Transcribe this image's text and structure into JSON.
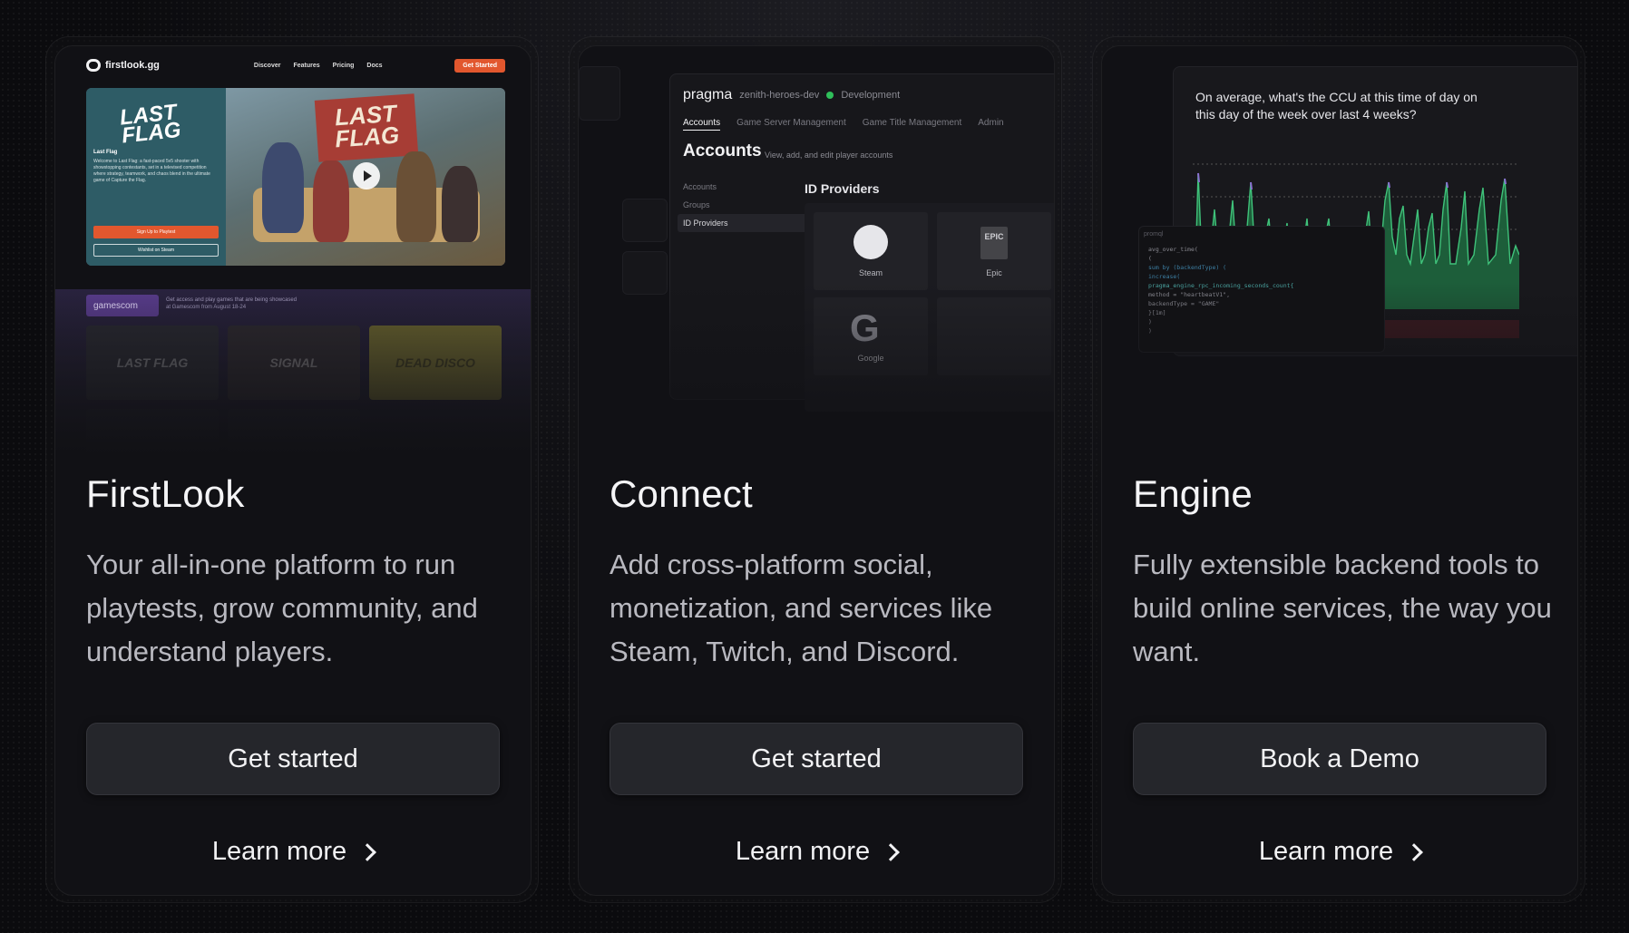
{
  "cards": [
    {
      "title": "FirstLook",
      "description": "Your all-in-one platform to run playtests, grow community, and understand players.",
      "cta_label": "Get started",
      "learn_more_label": "Learn more",
      "preview": {
        "logo": "firstlook.gg",
        "nav": [
          "Discover",
          "Features",
          "Pricing",
          "Docs"
        ],
        "nav_cta": "Get Started",
        "hero_logo": "LAST FLAG",
        "hero_title": "Last Flag",
        "hero_text": "Welcome to Last Flag: a fast-paced 5v5 shooter with showstopping contestants, set in a televised competition where strategy, teamwork, and chaos blend in the ultimate game of Capture the Flag.",
        "hero_primary": "Sign Up to Playtest",
        "hero_secondary": "Wishlist on Steam",
        "banner_tag": "gamescom",
        "banner_text": "Get access and play games that are being showcased at Gamescom from August 18-24",
        "tiles": [
          "LAST FLAG",
          "SIGNAL",
          "DEAD DISCO"
        ]
      }
    },
    {
      "title": "Connect",
      "description": "Add cross-platform social, monetization, and services like Steam, Twitch, and Discord.",
      "cta_label": "Get started",
      "learn_more_label": "Learn more",
      "preview": {
        "brand": "pragma",
        "project": "zenith-heroes-dev",
        "environment": "Development",
        "tabs": [
          "Accounts",
          "Game Server Management",
          "Game Title Management",
          "Admin"
        ],
        "heading": "Accounts",
        "subheading": "View, add, and edit player accounts",
        "side_items": [
          "Accounts",
          "Groups",
          "ID Providers"
        ],
        "section": "ID Providers",
        "providers": [
          "Steam",
          "Epic",
          "Google"
        ]
      }
    },
    {
      "title": "Engine",
      "description": "Fully extensible backend tools to build online services, the way you want.",
      "cta_label": "Book a Demo",
      "learn_more_label": "Learn more",
      "preview": {
        "question": "On average, what's the CCU at this time of day on this day of the week over last 4 weeks?",
        "code_label": "promql",
        "code": [
          "avg_over_time(",
          "  (",
          "    sum by (backendType) (",
          "      increase(",
          "        pragma_engine_rpc_incoming_seconds_count{",
          "          method = \"heartbeatV1\",",
          "          backendType = \"GAME\"",
          "        }[1m]",
          "      )",
          "    )"
        ]
      }
    }
  ],
  "colors": {
    "background": "#0b0b0e",
    "card": "#111115",
    "button": "#25262b",
    "accent_orange": "#e2572e",
    "accent_green": "#2fbf5a"
  }
}
